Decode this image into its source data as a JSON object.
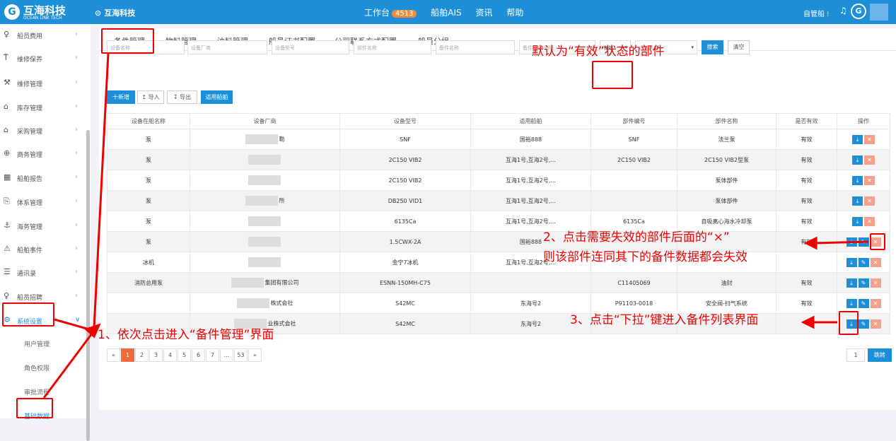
{
  "topbar": {
    "logo_mark": "G",
    "logo_name": "互海科技",
    "logo_sub": "OCEAN LINK TECH",
    "crumb_icon": "⊙",
    "crumb": "互海科技",
    "nav": [
      {
        "label": "工作台",
        "badge": "4513"
      },
      {
        "label": "船舶AIS"
      },
      {
        "label": "资讯"
      },
      {
        "label": "帮助"
      }
    ],
    "user": "自管船 ⁝",
    "bell": "♫",
    "avatar": "G"
  },
  "sidebar": {
    "items": [
      {
        "icon": "♀",
        "label": "船员费用"
      },
      {
        "icon": "Ť",
        "label": "维修保养"
      },
      {
        "icon": "⚒",
        "label": "维修管理"
      },
      {
        "icon": "⌂",
        "label": "库存管理"
      },
      {
        "icon": "⌂",
        "label": "采购管理"
      },
      {
        "icon": "⊕",
        "label": "商务管理"
      },
      {
        "icon": "▦",
        "label": "船舶报告"
      },
      {
        "icon": "⎘",
        "label": "体系管理"
      },
      {
        "icon": "⚓",
        "label": "海务管理"
      },
      {
        "icon": "⚠",
        "label": "船舶事件"
      },
      {
        "icon": "☰",
        "label": "通讯录"
      },
      {
        "icon": "♀",
        "label": "船员招聘"
      },
      {
        "icon": "⚙",
        "label": "系统设置"
      }
    ],
    "subitems": [
      {
        "label": "用户管理"
      },
      {
        "label": "角色权限"
      },
      {
        "label": "审批流程"
      },
      {
        "label": "基础数据"
      }
    ]
  },
  "tabs": [
    "备件管理",
    "物料管理",
    "油料管理",
    "船员证书配置",
    "公司联系方式配置",
    "船员分组"
  ],
  "filters": {
    "equipment_name": "设备名称",
    "maker": "设备厂商",
    "model": "设备型号",
    "part_name": "部件名称",
    "spare_name": "备件名称",
    "spare_code": "备件代号/图纸",
    "status": "有效",
    "ship": "适用船舶",
    "search": "搜索",
    "clear": "清空"
  },
  "actions": {
    "add": "十新增",
    "import": "↥ 导入",
    "export": "↧ 导出",
    "apply_ship": "适用船舶"
  },
  "table": {
    "headers": [
      "设备在船名称",
      "设备厂商",
      "设备型号",
      "适用船舶",
      "部件编号",
      "部件名称",
      "是否有效",
      "操作"
    ],
    "rows": [
      {
        "name": "泵",
        "maker": "勒",
        "model": "SNF",
        "ship": "国裕888",
        "code": "SNF",
        "part": "法兰泵",
        "valid": "有效"
      },
      {
        "name": "泵",
        "maker": "",
        "model": "2C150 VIB2",
        "ship": "互海1号,互海2号,...",
        "code": "2C150 VIB2",
        "part": "2C150 VIB2型泵",
        "valid": "有效"
      },
      {
        "name": "泵",
        "maker": "",
        "model": "2C150 VIB2",
        "ship": "互海1号,互海2号,...",
        "code": "",
        "part": "泵体部件",
        "valid": "有效"
      },
      {
        "name": "泵",
        "maker": "所",
        "model": "DB250 VID1",
        "ship": "互海1号,互海2号,...",
        "code": "",
        "part": "泵体部件",
        "valid": "有效"
      },
      {
        "name": "泵",
        "maker": "",
        "model": "6135Ca",
        "ship": "互海1号,互海2号,...",
        "code": "6135Ca",
        "part": "自吸离心海水冷却泵",
        "valid": "有效"
      },
      {
        "name": "泵",
        "maker": "",
        "model": "1.5CWX-2A",
        "ship": "国裕888",
        "code": "",
        "part": "",
        "valid": "有效"
      },
      {
        "name": "冰机",
        "maker": "",
        "model": "金宁7冰机",
        "ship": "互海1号,互海2号,...",
        "code": "",
        "part": "",
        "valid": ""
      },
      {
        "name": "消防总用泵",
        "maker": "集团有限公司",
        "model": "ESNN-150MH-C75",
        "ship": "",
        "code": "C11405069",
        "part": "油封",
        "valid": "有效"
      },
      {
        "name": "",
        "maker": "株式会社",
        "model": "S42MC",
        "ship": "东海号2",
        "code": "P91103-0018",
        "part": "安全阀-扫气系统",
        "valid": "有效"
      },
      {
        "name": "",
        "maker": "业株式会社",
        "model": "S42MC",
        "ship": "东海号2",
        "code": "",
        "part": "",
        "valid": ""
      }
    ]
  },
  "pager": {
    "prev": "«",
    "pages": [
      "1",
      "2",
      "3",
      "4",
      "5",
      "6",
      "7",
      "...",
      "53"
    ],
    "next": "»",
    "jump_value": "1",
    "jump": "跳转"
  },
  "annotations": {
    "top": "默认为“有效”状态的部件",
    "a1": "1、依次点击进入“备件管理”界面",
    "a2_1": "2、点击需要失效的部件后面的“×”",
    "a2_2": "则该部件连同其下的备件数据都会失效",
    "a3": "3、点击“下拉”键进入备件列表界面"
  },
  "colors": {
    "brand": "#1c8fd8",
    "annotation": "#e00000",
    "delete": "#f5a08c",
    "page_current": "#f06a3c"
  }
}
